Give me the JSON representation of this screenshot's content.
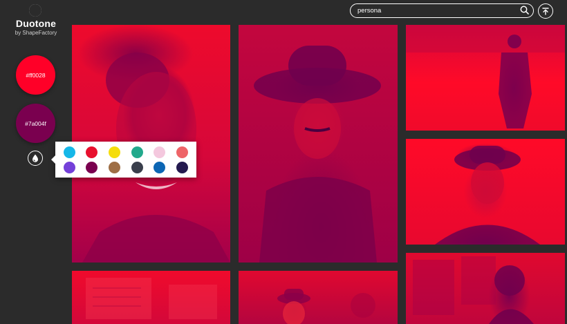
{
  "brand": {
    "title": "Duotone",
    "subtitle": "by ShapeFactory"
  },
  "swatches": {
    "primary": {
      "label": "#ff0028",
      "color": "#ff0028"
    },
    "secondary": {
      "label": "#7a004f",
      "color": "#7a004f"
    }
  },
  "palette": {
    "colors": [
      "#15b7e8",
      "#e8102e",
      "#f5dd0c",
      "#22a98c",
      "#f4c8de",
      "#ee6468",
      "#7440d9",
      "#7a004f",
      "#9e6e45",
      "#3a3f4c",
      "#0c66b4",
      "#241a4f"
    ]
  },
  "search": {
    "value": "persona",
    "icon": "search-icon"
  },
  "toolbar": {
    "upload_icon": "upload-icon"
  },
  "photos": [
    {
      "name": "photo-smiling-woman"
    },
    {
      "name": "photo-woman-in-hat"
    },
    {
      "name": "photo-man-walking"
    },
    {
      "name": "photo-woman-sunset-hat"
    },
    {
      "name": "photo-wall-notes"
    },
    {
      "name": "photo-crowd-man-hat"
    },
    {
      "name": "photo-street-posters"
    }
  ]
}
